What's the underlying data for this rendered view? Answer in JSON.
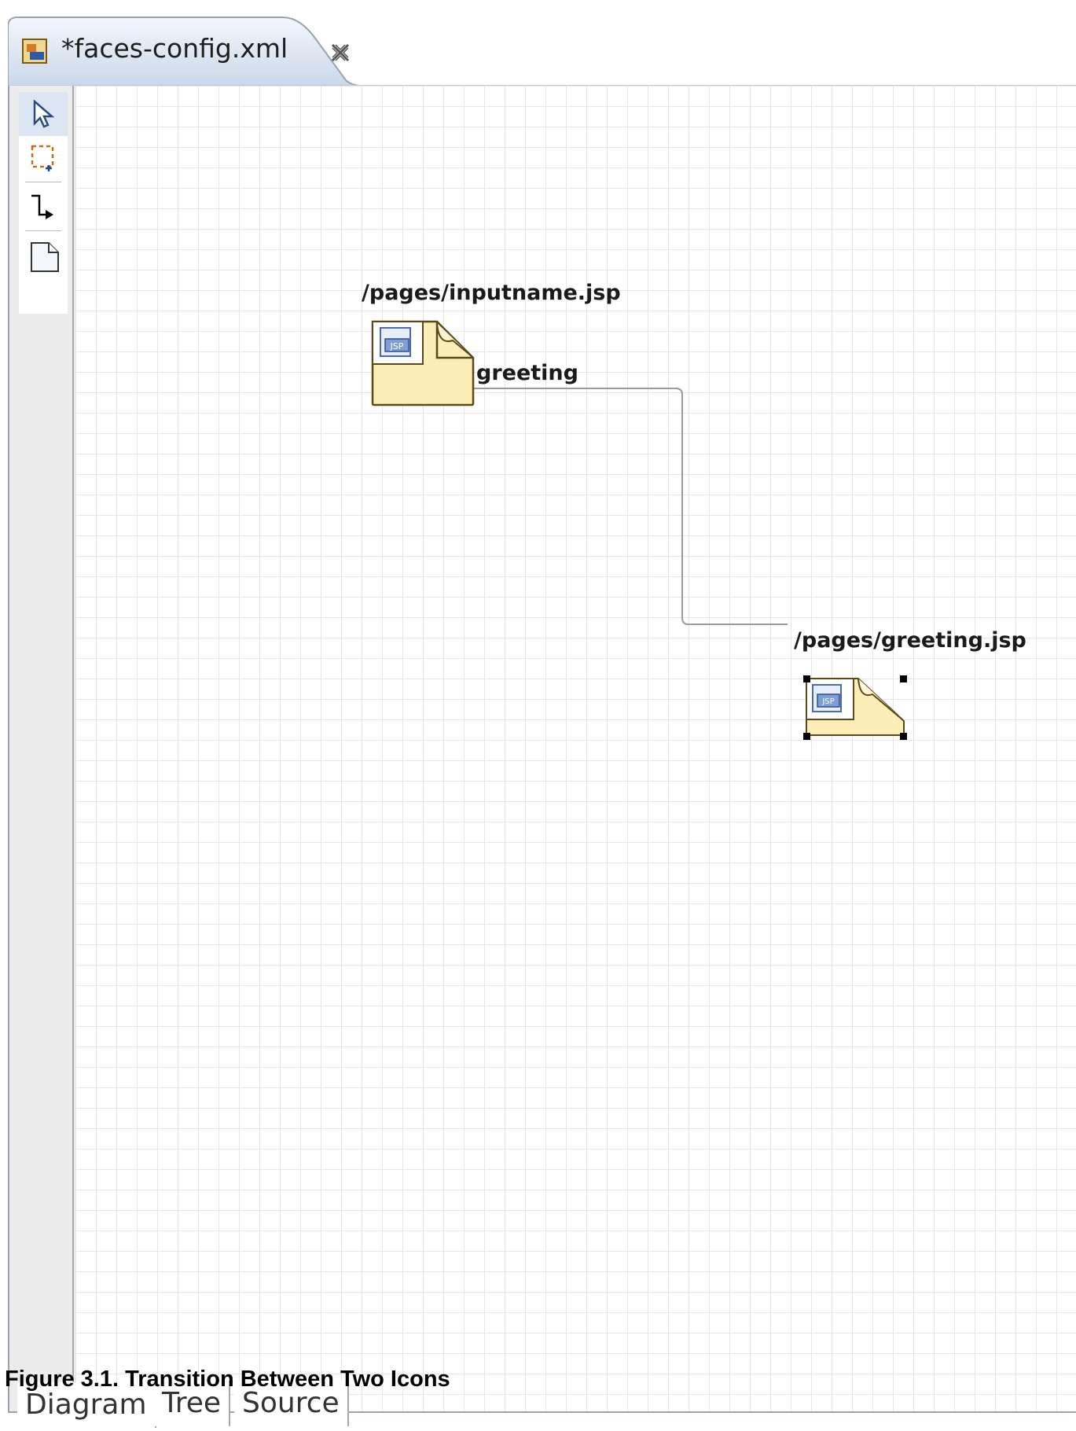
{
  "editor": {
    "tab_title": "*faces-config.xml",
    "tab_icon": "faces-config-file-icon",
    "close_icon": "close-icon"
  },
  "palette": {
    "tools": [
      {
        "name": "select-tool",
        "icon": "arrow-pointer-icon"
      },
      {
        "name": "marquee-tool",
        "icon": "marquee-select-icon"
      },
      {
        "name": "transition-tool",
        "icon": "connection-arrow-icon"
      },
      {
        "name": "page-tool",
        "icon": "page-icon"
      }
    ]
  },
  "diagram": {
    "nodes": [
      {
        "label": "/pages/inputname.jsp",
        "icon": "jsp-page-icon",
        "selected": false
      },
      {
        "label": "/pages/greeting.jsp",
        "icon": "jsp-page-icon",
        "selected": true
      }
    ],
    "transitions": [
      {
        "label": "greeting",
        "from": "/pages/inputname.jsp",
        "to": "/pages/greeting.jsp"
      }
    ]
  },
  "bottom_tabs": [
    "Diagram",
    "Tree",
    "Source"
  ],
  "caption": "Figure 3.1. Transition Between Two Icons",
  "colors": {
    "page_fill": "#fdeeb8",
    "page_stroke": "#5a4a1a",
    "connection": "#9a9a9a",
    "grid": "#e6e6e6"
  }
}
